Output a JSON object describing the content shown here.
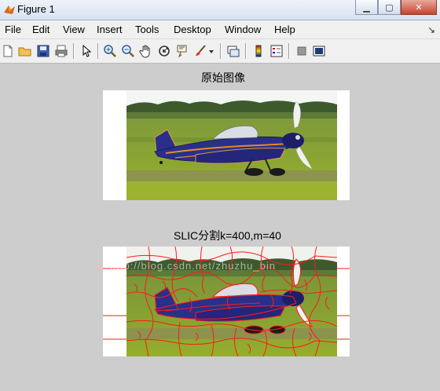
{
  "window": {
    "title": "Figure 1",
    "minimize_icon": "minimize-icon",
    "maximize_icon": "maximize-icon",
    "close_icon": "close-icon"
  },
  "menu": {
    "items": [
      "File",
      "Edit",
      "View",
      "Insert",
      "Tools",
      "Desktop",
      "Window",
      "Help"
    ]
  },
  "toolbar": {
    "icons": [
      "new-figure-icon",
      "open-file-icon",
      "save-icon",
      "print-icon",
      "edit-plot-icon",
      "zoom-in-icon",
      "zoom-out-icon",
      "pan-icon",
      "rotate-3d-icon",
      "data-cursor-icon",
      "brush-icon",
      "link-plot-icon",
      "colorbar-icon",
      "legend-icon",
      "hide-plot-tools-icon",
      "show-plot-tools-icon"
    ]
  },
  "axes": [
    {
      "title": "原始图像"
    },
    {
      "title": "SLIC分割k=400,m=40"
    }
  ],
  "watermark": "http://blog.csdn.net/zhuzhu_bin",
  "colors": {
    "canvas_bg": "#cdcdcd",
    "segment_boundary": "#ff1a1a",
    "plane_body": "#2a2f8a",
    "grass": "#7aa52a"
  }
}
